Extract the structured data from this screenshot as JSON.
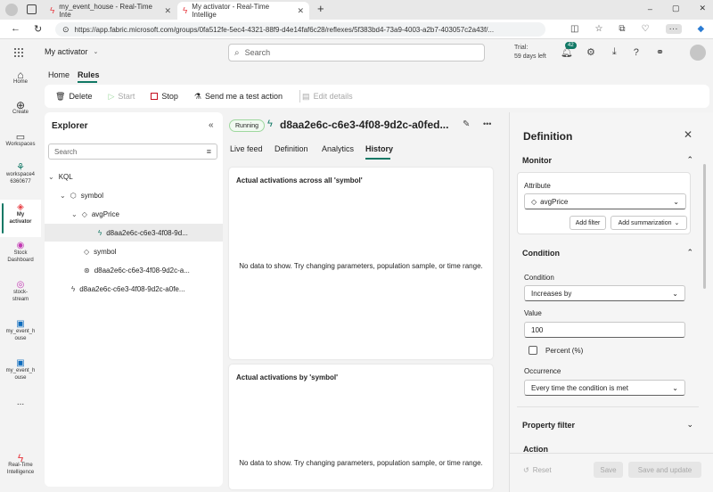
{
  "browser": {
    "tabs": [
      {
        "title": "my_event_house - Real-Time Inte"
      },
      {
        "title": "My activator - Real-Time Intellige"
      }
    ],
    "new_tab": "+",
    "url": "https://app.fabric.microsoft.com/groups/0fa512fe-5ec4-4321-88f9-d4e14faf6c28/reflexes/5f383bd4-73a9-4003-a2b7-403057c2a43f/...",
    "window_controls": [
      "–",
      "▢",
      "✕"
    ]
  },
  "header": {
    "item_name": "My activator",
    "search_placeholder": "Search",
    "trial_line1": "Trial:",
    "trial_line2": "59 days left",
    "notification_count": "42"
  },
  "rail": {
    "items": [
      {
        "label": "Home"
      },
      {
        "label": "Create"
      },
      {
        "label": "Workspaces"
      },
      {
        "label": "workspace4 6360677"
      },
      {
        "label": "My activator"
      },
      {
        "label": "Stock Dashboard"
      },
      {
        "label": "stock-stream"
      },
      {
        "label": "my_event_h ouse"
      },
      {
        "label": "my_event_h ouse"
      },
      {
        "label": "..."
      }
    ],
    "bottom_label": "Real-Time Intelligence"
  },
  "ribbon": {
    "tabs": [
      "Home",
      "Rules"
    ],
    "active_tab": "Rules",
    "buttons": {
      "delete": "Delete",
      "start": "Start",
      "stop": "Stop",
      "test": "Send me a test action",
      "edit": "Edit details"
    }
  },
  "explorer": {
    "title": "Explorer",
    "search_placeholder": "Search",
    "tree": [
      {
        "label": "KQL"
      },
      {
        "label": "symbol"
      },
      {
        "label": "avgPrice"
      },
      {
        "label": "d8aa2e6c-c6e3-4f08-9d..."
      },
      {
        "label": "symbol"
      },
      {
        "label": "d8aa2e6c-c6e3-4f08-9d2c-a..."
      },
      {
        "label": "d8aa2e6c-c6e3-4f08-9d2c-a0fe..."
      }
    ]
  },
  "rule": {
    "status": "Running",
    "name": "d8aa2e6c-c6e3-4f08-9d2c-a0fed...",
    "more": "•••",
    "tabs": [
      "Live feed",
      "Definition",
      "Analytics",
      "History"
    ],
    "active_tab": "History",
    "cards": [
      {
        "title": "Actual activations across all 'symbol'",
        "message": "No data to show. Try changing parameters, population sample, or time range."
      },
      {
        "title": "Actual activations by 'symbol'",
        "message": "No data to show. Try changing parameters, population sample, or time range."
      }
    ]
  },
  "definition": {
    "title": "Definition",
    "monitor": {
      "heading": "Monitor",
      "attribute_label": "Attribute",
      "attribute_value": "avgPrice",
      "add_filter": "Add filter",
      "add_summarization": "Add summarization"
    },
    "condition": {
      "heading": "Condition",
      "condition_label": "Condition",
      "condition_value": "Increases by",
      "value_label": "Value",
      "value": "100",
      "percent_label": "Percent (%)",
      "occurrence_label": "Occurrence",
      "occurrence_value": "Every time the condition is met"
    },
    "property_filter": "Property filter",
    "next_section_partial": "Action",
    "footer": {
      "reset": "Reset",
      "save": "Save",
      "save_update": "Save and update"
    }
  },
  "colors": {
    "accent": "#117865",
    "running_badge_bg": "#f1faf1",
    "running_badge_border": "#9fd89f",
    "stop_red": "#c50f1f",
    "activator_red": "#e8444a"
  }
}
